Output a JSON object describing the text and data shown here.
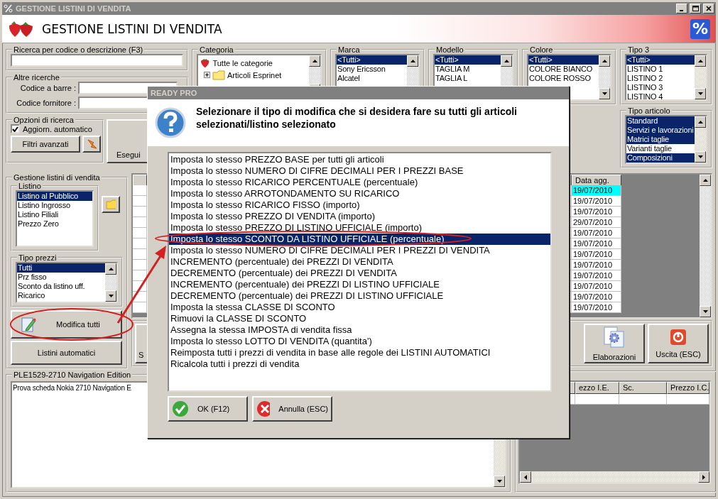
{
  "window": {
    "title": "GESTIONE LISTINI DI VENDITA"
  },
  "header": {
    "title": "GESTIONE LISTINI DI VENDITA",
    "badge": "%"
  },
  "search": {
    "label": "Ricerca per codice o descrizione (F3)"
  },
  "other_searches": {
    "label": "Altre ricerche",
    "fields": [
      {
        "label": "Codice a barre :"
      },
      {
        "label": "Codice fornitore :"
      }
    ]
  },
  "search_options": {
    "label": "Opzioni di ricerca",
    "auto_update": {
      "label": "Aggiorn. automatico",
      "checked": true
    },
    "filters_button": "Filtri avanzati"
  },
  "run_button": "Esegui",
  "category": {
    "label": "Categoria",
    "tree": [
      {
        "label": "Tutte le categorie",
        "children": [
          {
            "label": "Articoli Esprinet",
            "expanded": false
          }
        ]
      }
    ]
  },
  "filters": [
    {
      "label": "Marca",
      "items": [
        {
          "label": "<Tutti>",
          "selected": true
        },
        {
          "label": "Sony Ericsson",
          "selected": false
        },
        {
          "label": "Alcatel",
          "selected": false
        }
      ]
    },
    {
      "label": "Modello",
      "items": [
        {
          "label": "<Tutti>",
          "selected": true
        },
        {
          "label": "TAGLIA M",
          "selected": false
        },
        {
          "label": "TAGLIA L",
          "selected": false
        }
      ]
    },
    {
      "label": "Colore",
      "items": [
        {
          "label": "<Tutti>",
          "selected": true
        },
        {
          "label": "COLORE BIANCO",
          "selected": false
        },
        {
          "label": "COLORE ROSSO",
          "selected": false
        }
      ]
    },
    {
      "label": "Tipo 3",
      "items": [
        {
          "label": "<Tutti>",
          "selected": true
        },
        {
          "label": "LISTINO 1",
          "selected": false
        },
        {
          "label": "LISTINO 2",
          "selected": false
        },
        {
          "label": "LISTINO 3",
          "selected": false
        },
        {
          "label": "LISTINO 4",
          "selected": false
        }
      ]
    }
  ],
  "article_type": {
    "label": "Tipo articolo",
    "items": [
      {
        "label": "Standard",
        "selected": true
      },
      {
        "label": "Servizi e lavorazioni",
        "selected": true
      },
      {
        "label": "Matrici taglie",
        "selected": true
      },
      {
        "label": "Varianti taglie",
        "selected": false
      },
      {
        "label": "Composizioni",
        "selected": true
      }
    ]
  },
  "price_lists": {
    "label": "Gestione listini di vendita",
    "list": {
      "label": "Listino",
      "items": [
        {
          "label": "Listino al Pubblico",
          "selected": true
        },
        {
          "label": "Listino Ingrosso",
          "selected": false
        },
        {
          "label": "Listino Filiali",
          "selected": false
        },
        {
          "label": "Prezzo Zero",
          "selected": false
        }
      ]
    },
    "price_types": {
      "label": "Tipo prezzi",
      "items": [
        {
          "label": "Tutti",
          "selected": true
        },
        {
          "label": "Prz fisso",
          "selected": false
        },
        {
          "label": "Sconto da listino uff.",
          "selected": false
        },
        {
          "label": "Ricarico",
          "selected": false
        }
      ]
    },
    "buttons": [
      {
        "label": "Modifica tutti",
        "kind": "edit"
      },
      {
        "label": "Listini automatici",
        "kind": "plain"
      }
    ]
  },
  "grid": {
    "columns": [
      "Data agg."
    ],
    "rows": [
      {
        "cells": [
          "19/07/2010"
        ],
        "selected": true
      },
      {
        "cells": [
          "19/07/2010"
        ],
        "selected": false
      },
      {
        "cells": [
          "19/07/2010"
        ],
        "selected": false
      },
      {
        "cells": [
          "29/07/2010"
        ],
        "selected": false
      },
      {
        "cells": [
          "19/07/2010"
        ],
        "selected": false
      },
      {
        "cells": [
          "19/07/2010"
        ],
        "selected": false
      },
      {
        "cells": [
          "19/07/2010"
        ],
        "selected": false
      },
      {
        "cells": [
          "19/07/2010"
        ],
        "selected": false
      },
      {
        "cells": [
          "19/07/2010"
        ],
        "selected": false
      },
      {
        "cells": [
          "19/07/2010"
        ],
        "selected": false
      },
      {
        "cells": [
          "19/07/2010"
        ],
        "selected": false
      },
      {
        "cells": [
          "19/07/2010"
        ],
        "selected": false
      }
    ]
  },
  "actions": [
    {
      "label": "S",
      "kind": "partial"
    },
    {
      "label": "Elaborazioni",
      "kind": "process"
    },
    {
      "label": "Uscita (ESC)",
      "kind": "exit"
    }
  ],
  "note": {
    "label": "PLE1529-2710 Navigation Edition",
    "text": "Prova scheda Nokia 2710 Navigation E"
  },
  "prices_table": {
    "columns": [
      "ezzo I.E.",
      "Sc.",
      "Prezzo I.C."
    ]
  },
  "dialog": {
    "title": "READY PRO",
    "message": "Selezionare il tipo di modifica che si desidera fare su tutti gli articoli selezionati/listino selezionato",
    "options": [
      {
        "label": "Imposta lo stesso PREZZO BASE per tutti gli articoli",
        "selected": false
      },
      {
        "label": "Imposta lo stesso NUMERO DI CIFRE DECIMALI PER I PREZZI BASE",
        "selected": false
      },
      {
        "label": "Imposta lo stesso RICARICO PERCENTUALE (percentuale)",
        "selected": false
      },
      {
        "label": "Imposta lo stesso ARROTONDAMENTO SU RICARICO",
        "selected": false
      },
      {
        "label": "Imposta lo stesso RICARICO FISSO (importo)",
        "selected": false
      },
      {
        "label": "Imposta lo stesso PREZZO DI VENDITA (importo)",
        "selected": false
      },
      {
        "label": "Imposta lo stesso PREZZO DI LISTINO UFFICIALE (importo)",
        "selected": false
      },
      {
        "label": "Imposta lo stesso SCONTO DA LISTINO UFFICIALE (percentuale)",
        "selected": true
      },
      {
        "label": "Imposta lo stesso NUMERO DI CIFRE DECIMALI PER I PREZZI DI VENDITA",
        "selected": false
      },
      {
        "label": "INCREMENTO (percentuale) dei PREZZI DI VENDITA",
        "selected": false
      },
      {
        "label": "DECREMENTO (percentuale) dei PREZZI DI VENDITA",
        "selected": false
      },
      {
        "label": "INCREMENTO (percentuale) dei PREZZI DI LISTINO UFFICIALE",
        "selected": false
      },
      {
        "label": "DECREMENTO (percentuale) dei PREZZI DI LISTINO UFFICIALE",
        "selected": false
      },
      {
        "label": "Imposta la stessa CLASSE DI SCONTO",
        "selected": false
      },
      {
        "label": "Rimuovi la CLASSE DI SCONTO",
        "selected": false
      },
      {
        "label": "Assegna la stessa IMPOSTA di vendita fissa",
        "selected": false
      },
      {
        "label": "Imposta lo stesso LOTTO DI VENDITA (quantita')",
        "selected": false
      },
      {
        "label": "Reimposta tutti i prezzi di vendita in base alle regole dei LISTINI AUTOMATICI",
        "selected": false
      },
      {
        "label": "Ricalcola tutti i prezzi di vendita",
        "selected": false
      }
    ],
    "buttons": [
      {
        "label": "OK (F12)",
        "kind": "ok"
      },
      {
        "label": "Annulla (ESC)",
        "kind": "cancel"
      }
    ]
  }
}
